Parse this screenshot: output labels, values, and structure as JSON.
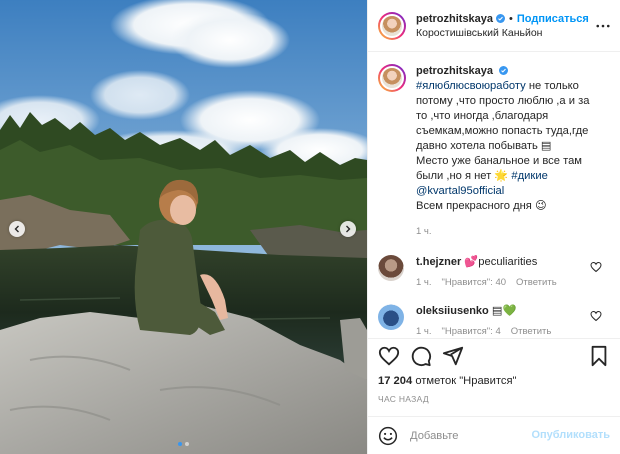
{
  "post": {
    "username": "petrozhitskaya",
    "follow_label": "Подписаться",
    "separator": "•",
    "location": "Коростишівський Каньйон",
    "caption_lines": [
      {
        "tag": "#ялюблюсвоюработу",
        "text": " не только"
      },
      {
        "text": "потому ,что просто люблю ,а и за"
      },
      {
        "text": "то ,что иногда ,благодаря"
      },
      {
        "text": "съемкам,можно попасть туда,где"
      },
      {
        "text": "давно хотела побывать ▤"
      },
      {
        "text": "Место уже банальное и все там"
      },
      {
        "text": "были ,но я нет ",
        "emoji": "🌟",
        "tag": " #дикие"
      },
      {
        "tag": "@kvartal95official"
      },
      {
        "text": "Всем прекрасного дня ",
        "emoji": "😉"
      }
    ],
    "caption_time": "1 ч.",
    "comments": [
      {
        "username": "t.hejzner",
        "emoji": "💕",
        "text": "peculiarities",
        "time": "1 ч.",
        "likes": "\"Нравится\": 40",
        "reply": "Ответить"
      },
      {
        "username": "oleksiiusenko",
        "emoji": "▤💚",
        "text": "",
        "time": "1 ч.",
        "likes": "\"Нравится\": 4",
        "reply": "Ответить"
      }
    ],
    "likes_count": "17 204",
    "likes_text": " отметок \"Нравится\"",
    "time_ago": "ЧАС НАЗАД",
    "comment_placeholder": "Добавьте",
    "publish_label": "Опубликовать",
    "icons": [
      "more-icon",
      "heart-icon",
      "comment-icon",
      "share-icon",
      "bookmark-icon",
      "smile-icon",
      "verified-icon"
    ],
    "colors": {
      "accent": "#0095f6",
      "publish_disabled": "#b2dffc",
      "tag": "#00376b",
      "muted": "#8e8e8e",
      "verified": "#3897f0"
    },
    "carousel": {
      "slide_count": 2,
      "active_index": 0
    }
  }
}
